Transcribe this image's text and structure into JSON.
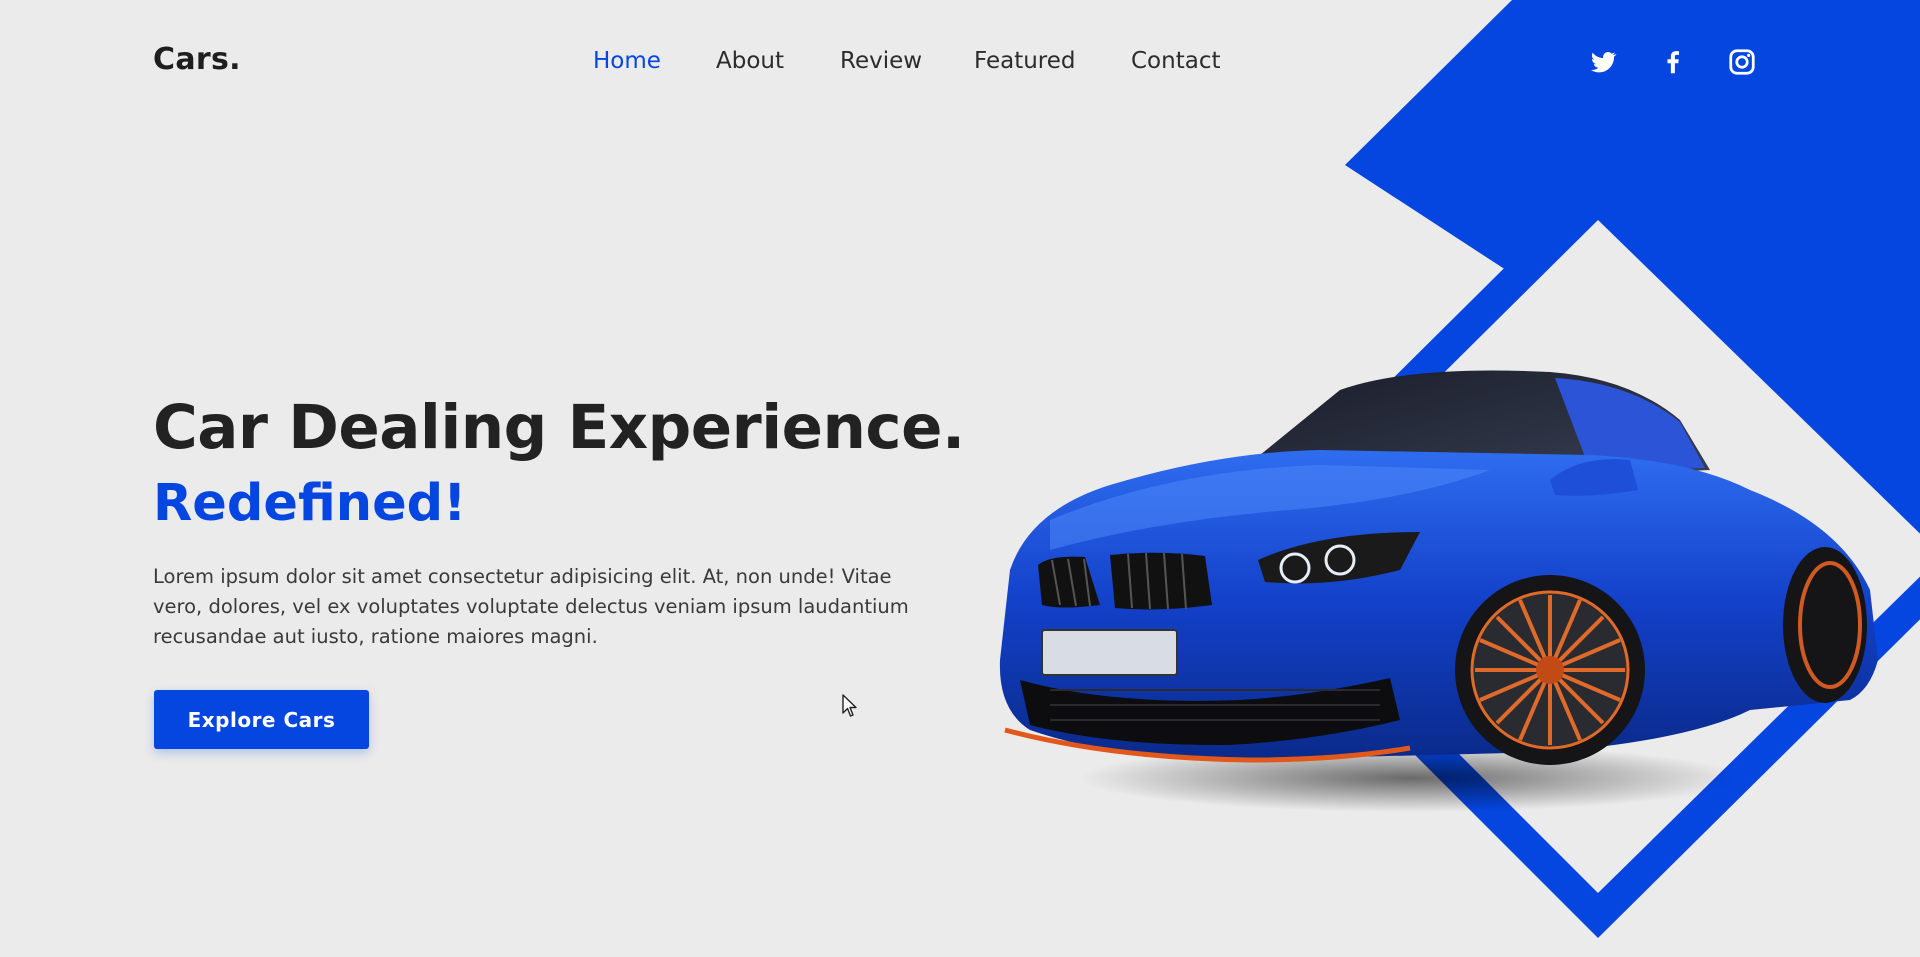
{
  "brand": {
    "logo": "Cars."
  },
  "nav": {
    "items": [
      {
        "label": "Home",
        "active": true
      },
      {
        "label": "About",
        "active": false
      },
      {
        "label": "Review",
        "active": false
      },
      {
        "label": "Featured",
        "active": false
      },
      {
        "label": "Contact",
        "active": false
      }
    ]
  },
  "social": {
    "icons": [
      "twitter-icon",
      "facebook-icon",
      "instagram-icon"
    ]
  },
  "hero": {
    "title": "Car Dealing Experience.",
    "subtitle": "Redefined!",
    "description": "Lorem ipsum dolor sit amet consectetur adipisicing elit. At, non unde! Vitae vero, dolores, vel ex voluptates voluptate delectus veniam ipsum laudantium recusandae aut iusto, ratione maiores magni.",
    "cta_label": "Explore Cars"
  },
  "colors": {
    "accent": "#0546e0",
    "background": "#ebebeb",
    "text": "#222222"
  }
}
